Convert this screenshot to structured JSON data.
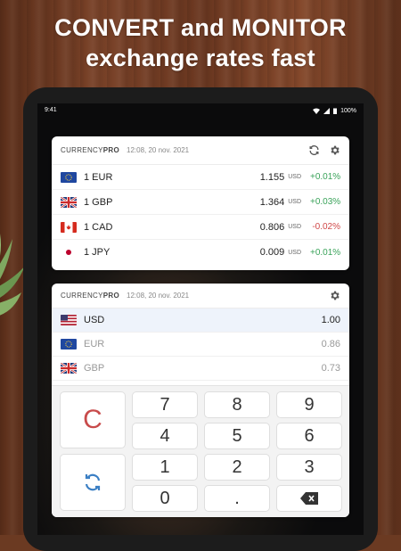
{
  "headline": {
    "line1": "CONVERT and MONITOR",
    "line2": "exchange rates fast"
  },
  "status": {
    "time": "9:41",
    "battery": "100%"
  },
  "rates_widget": {
    "brand_light": "CURRENCY",
    "brand_bold": "PRO",
    "timestamp": "12:08, 20 nov. 2021",
    "rows": [
      {
        "label": "1 EUR",
        "value": "1.155",
        "unit": "USD",
        "change": "+0.01%",
        "trend": "up",
        "flag": "eu"
      },
      {
        "label": "1 GBP",
        "value": "1.364",
        "unit": "USD",
        "change": "+0.03%",
        "trend": "up",
        "flag": "gb"
      },
      {
        "label": "1 CAD",
        "value": "0.806",
        "unit": "USD",
        "change": "-0.02%",
        "trend": "down",
        "flag": "ca"
      },
      {
        "label": "1 JPY",
        "value": "0.009",
        "unit": "USD",
        "change": "+0.01%",
        "trend": "up",
        "flag": "jp"
      }
    ]
  },
  "converter_widget": {
    "brand_light": "CURRENCY",
    "brand_bold": "PRO",
    "timestamp": "12:08, 20 nov. 2021",
    "rows": [
      {
        "code": "USD",
        "value": "1.00",
        "flag": "us"
      },
      {
        "code": "EUR",
        "value": "0.86",
        "flag": "eu"
      },
      {
        "code": "GBP",
        "value": "0.73",
        "flag": "gb"
      }
    ],
    "keys": {
      "clear": "C",
      "k7": "7",
      "k8": "8",
      "k9": "9",
      "k4": "4",
      "k5": "5",
      "k6": "6",
      "k1": "1",
      "k2": "2",
      "k3": "3",
      "k0": "0",
      "dot": "."
    }
  },
  "icons": [
    "refresh-icon",
    "gear-icon",
    "swap-icon",
    "backspace-icon",
    "wifi-icon",
    "signal-icon",
    "battery-icon"
  ],
  "colors": {
    "up": "#3aa35a",
    "down": "#d04848",
    "accent_blue": "#3b7fc4",
    "clear_red": "#c84b4b"
  }
}
